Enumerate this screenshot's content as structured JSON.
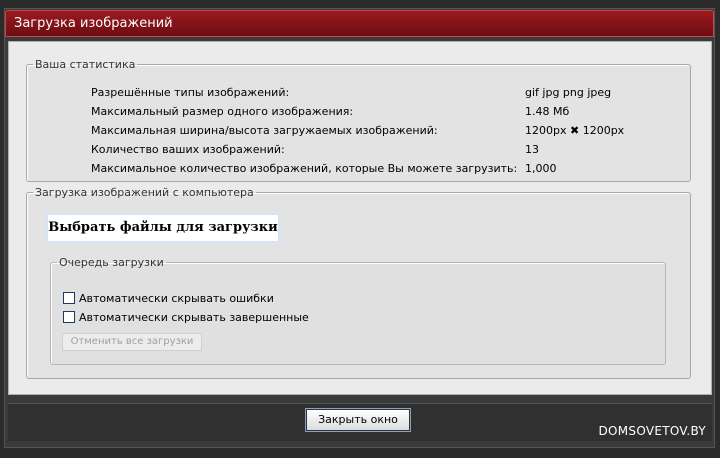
{
  "window": {
    "title": "Загрузка изображений"
  },
  "stats": {
    "legend": "Ваша статистика",
    "rows": [
      {
        "label": "Разрешённые типы изображений:",
        "value": "gif jpg png jpeg"
      },
      {
        "label": "Максимальный размер одного изображения:",
        "value": "1.48 Мб"
      },
      {
        "label": "Максимальная ширина/высота загружаемых изображений:",
        "value": "1200px ✖ 1200px"
      },
      {
        "label": "Количество ваших изображений:",
        "value": "13"
      },
      {
        "label": "Максимальное количество изображений, которые Вы можете загрузить:",
        "value": "1,000"
      }
    ]
  },
  "upload": {
    "legend": "Загрузка изображений с компьютера",
    "choose_label": "Выбрать файлы для загрузки",
    "queue": {
      "legend": "Очередь загрузки",
      "options": [
        {
          "label": "Автоматически скрывать ошибки",
          "checked": false
        },
        {
          "label": "Автоматически скрывать завершенные",
          "checked": false
        }
      ],
      "cancel_all_label": "Отменить все загрузки"
    }
  },
  "footer": {
    "close_label": "Закрыть окно"
  },
  "watermark": "DOMSOVETOV.BY"
}
